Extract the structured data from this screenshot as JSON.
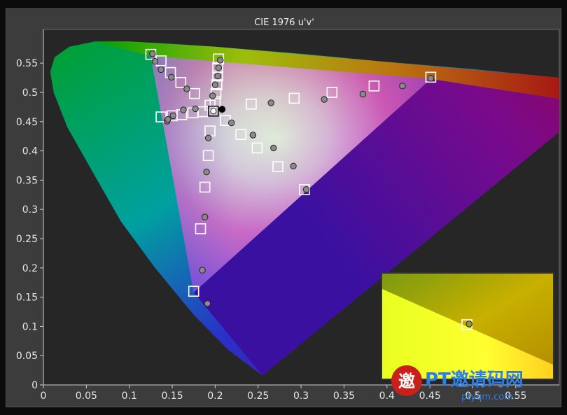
{
  "chart_data": {
    "type": "scatter",
    "title": "CIE 1976 u'v'",
    "xlim": [
      0,
      0.6
    ],
    "ylim": [
      0,
      0.6
    ],
    "x_ticks": [
      0,
      0.05,
      0.1,
      0.15,
      0.2,
      0.25,
      0.3,
      0.35,
      0.4,
      0.45,
      0.5,
      0.55
    ],
    "y_ticks": [
      0,
      0.05,
      0.1,
      0.15,
      0.2,
      0.25,
      0.3,
      0.35,
      0.4,
      0.45,
      0.5,
      0.55
    ],
    "x_tick_labels": [
      "0",
      "0.05",
      "0.1",
      "0.15",
      "0.2",
      "0.25",
      "0.3",
      "0.35",
      "0.4",
      "0.45",
      "0.5",
      "0.55"
    ],
    "y_tick_labels": [
      "0",
      "0.05",
      "0.1",
      "0.15",
      "0.2",
      "0.25",
      "0.3",
      "0.35",
      "0.4",
      "0.45",
      "0.5",
      "0.55"
    ],
    "grid": false,
    "gamut_triangle": [
      [
        0.451,
        0.523
      ],
      [
        0.125,
        0.562
      ],
      [
        0.175,
        0.158
      ]
    ],
    "white_point": {
      "u": 0.198,
      "v": 0.468
    },
    "target_points": [
      {
        "u": 0.125,
        "v": 0.565
      },
      {
        "u": 0.137,
        "v": 0.554
      },
      {
        "u": 0.148,
        "v": 0.534
      },
      {
        "u": 0.16,
        "v": 0.517
      },
      {
        "u": 0.176,
        "v": 0.498
      },
      {
        "u": 0.194,
        "v": 0.478
      },
      {
        "u": 0.204,
        "v": 0.557
      },
      {
        "u": 0.203,
        "v": 0.542
      },
      {
        "u": 0.203,
        "v": 0.528
      },
      {
        "u": 0.202,
        "v": 0.513
      },
      {
        "u": 0.201,
        "v": 0.498
      },
      {
        "u": 0.2,
        "v": 0.484
      },
      {
        "u": 0.137,
        "v": 0.458
      },
      {
        "u": 0.15,
        "v": 0.46
      },
      {
        "u": 0.161,
        "v": 0.462
      },
      {
        "u": 0.174,
        "v": 0.465
      },
      {
        "u": 0.186,
        "v": 0.467
      },
      {
        "u": 0.212,
        "v": 0.452
      },
      {
        "u": 0.23,
        "v": 0.428
      },
      {
        "u": 0.249,
        "v": 0.405
      },
      {
        "u": 0.273,
        "v": 0.373
      },
      {
        "u": 0.304,
        "v": 0.334
      },
      {
        "u": 0.194,
        "v": 0.434
      },
      {
        "u": 0.192,
        "v": 0.392
      },
      {
        "u": 0.188,
        "v": 0.338
      },
      {
        "u": 0.183,
        "v": 0.267
      },
      {
        "u": 0.175,
        "v": 0.16
      },
      {
        "u": 0.242,
        "v": 0.48
      },
      {
        "u": 0.292,
        "v": 0.49
      },
      {
        "u": 0.336,
        "v": 0.5
      },
      {
        "u": 0.385,
        "v": 0.511
      },
      {
        "u": 0.451,
        "v": 0.526
      }
    ],
    "measured_points": [
      {
        "u": 0.127,
        "v": 0.566
      },
      {
        "u": 0.13,
        "v": 0.553
      },
      {
        "u": 0.137,
        "v": 0.539
      },
      {
        "u": 0.149,
        "v": 0.526
      },
      {
        "u": 0.167,
        "v": 0.506
      },
      {
        "u": 0.197,
        "v": 0.494
      },
      {
        "u": 0.206,
        "v": 0.555
      },
      {
        "u": 0.204,
        "v": 0.542
      },
      {
        "u": 0.203,
        "v": 0.528
      },
      {
        "u": 0.2,
        "v": 0.513
      },
      {
        "u": 0.144,
        "v": 0.451
      },
      {
        "u": 0.145,
        "v": 0.454
      },
      {
        "u": 0.151,
        "v": 0.46
      },
      {
        "u": 0.163,
        "v": 0.47
      },
      {
        "u": 0.177,
        "v": 0.472
      },
      {
        "u": 0.219,
        "v": 0.448
      },
      {
        "u": 0.244,
        "v": 0.427
      },
      {
        "u": 0.268,
        "v": 0.405
      },
      {
        "u": 0.291,
        "v": 0.374
      },
      {
        "u": 0.306,
        "v": 0.334
      },
      {
        "u": 0.192,
        "v": 0.422
      },
      {
        "u": 0.19,
        "v": 0.364
      },
      {
        "u": 0.188,
        "v": 0.287
      },
      {
        "u": 0.185,
        "v": 0.196
      },
      {
        "u": 0.191,
        "v": 0.139
      },
      {
        "u": 0.265,
        "v": 0.482
      },
      {
        "u": 0.327,
        "v": 0.488
      },
      {
        "u": 0.372,
        "v": 0.497
      },
      {
        "u": 0.418,
        "v": 0.511
      },
      {
        "u": 0.451,
        "v": 0.524
      }
    ],
    "measured_white": {
      "u": 0.208,
      "v": 0.471
    },
    "inset": {
      "target": {
        "u": 0.198,
        "v": 0.468
      },
      "measured": {
        "u": 0.208,
        "v": 0.471
      }
    }
  },
  "watermark": {
    "badge_char": "邀",
    "brand_text": "PT邀请码网",
    "url_text": "ptyqm.com"
  }
}
